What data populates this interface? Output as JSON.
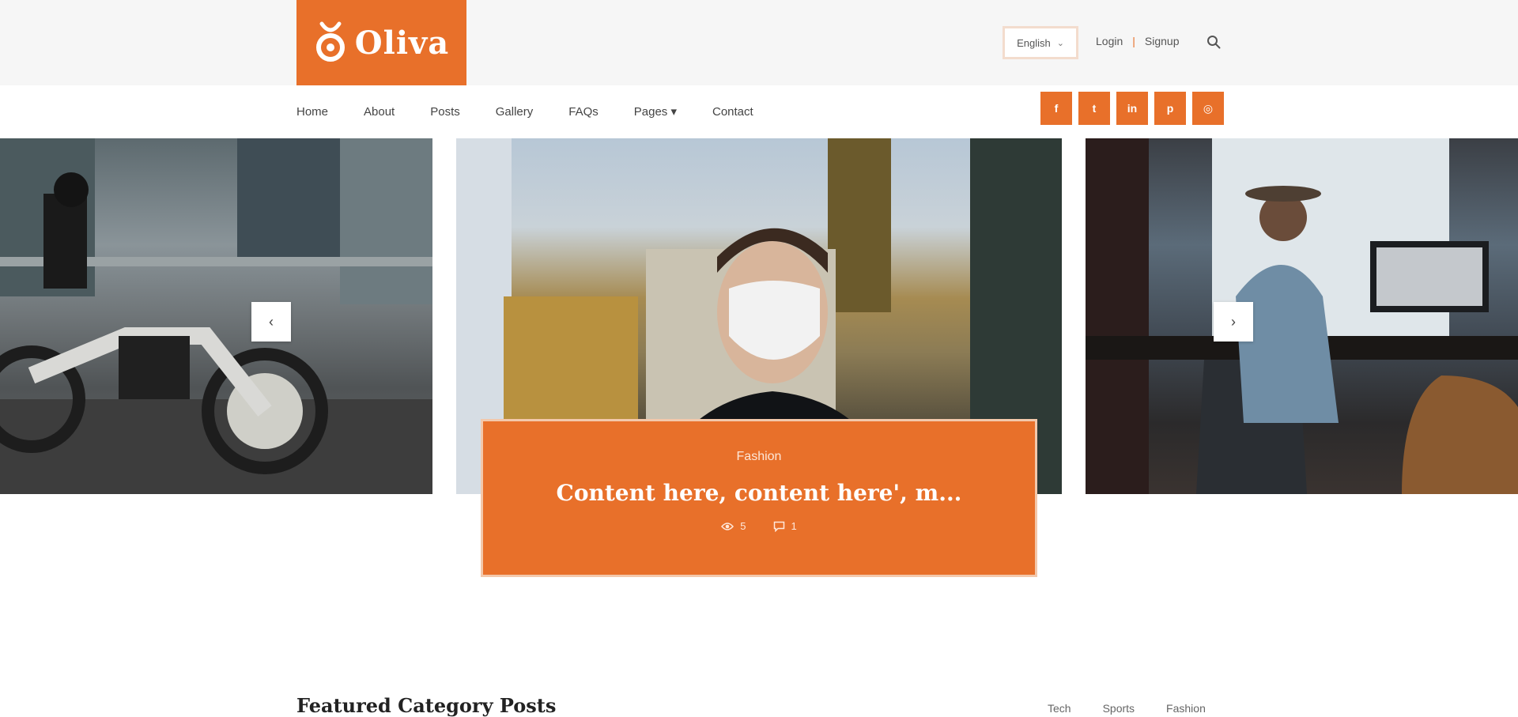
{
  "header": {
    "logo_text": "Oliva",
    "language": {
      "selected": "English"
    },
    "auth": {
      "login": "Login",
      "separator": "|",
      "signup": "Signup"
    }
  },
  "nav": {
    "items": [
      {
        "label": "Home"
      },
      {
        "label": "About"
      },
      {
        "label": "Posts"
      },
      {
        "label": "Gallery"
      },
      {
        "label": "FAQs"
      },
      {
        "label": "Pages ▾"
      },
      {
        "label": "Contact"
      }
    ]
  },
  "social": [
    {
      "icon": "facebook-icon",
      "glyph": "f"
    },
    {
      "icon": "twitter-icon",
      "glyph": "t"
    },
    {
      "icon": "linkedin-icon",
      "glyph": "in"
    },
    {
      "icon": "pinterest-icon",
      "glyph": "p"
    },
    {
      "icon": "instagram-icon",
      "glyph": "◎"
    }
  ],
  "slider": {
    "prev_glyph": "‹",
    "next_glyph": "›",
    "caption": {
      "category": "Fashion",
      "title": "Content here, content here', m...",
      "views": "5",
      "comments": "1"
    }
  },
  "section": {
    "title": "Featured Category Posts",
    "tabs": [
      "Tech",
      "Sports",
      "Fashion"
    ]
  },
  "colors": {
    "accent": "#e8702a",
    "topbar_bg": "#f6f6f6"
  }
}
